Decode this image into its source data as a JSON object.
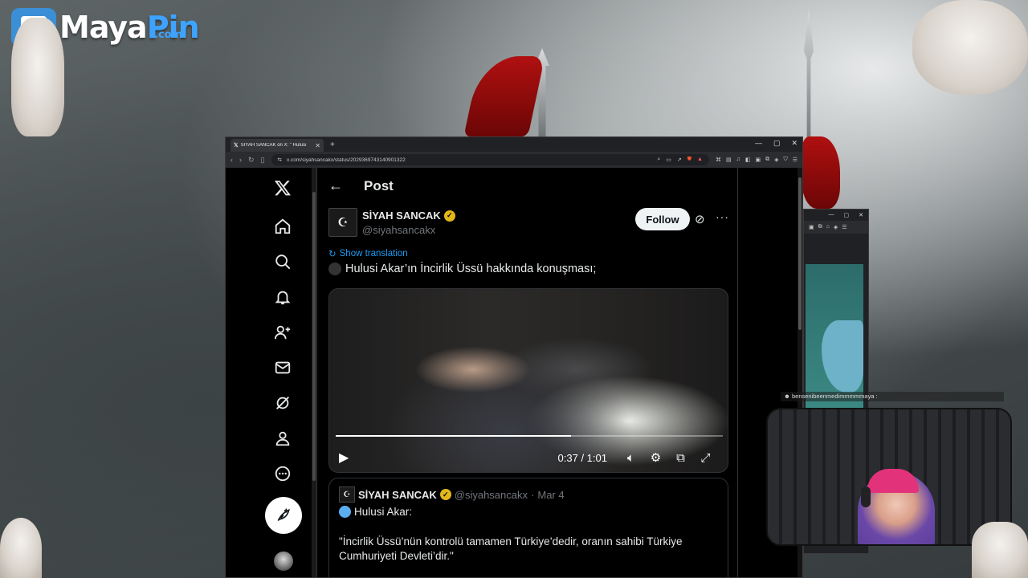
{
  "overlay": {
    "logo_main": "Maya",
    "logo_accent": "Pin",
    "logo_suffix": ".com",
    "chat_line": "☻ bensenibeenmedimmmmmaya :"
  },
  "browser": {
    "tab_title": "SİYAH SANCAK on X: \" Hulusi",
    "new_tab": "+",
    "url": "x.com/siyahsancakx/status/2029369743140901322"
  },
  "x": {
    "header_title": "Post",
    "author": {
      "name": "SİYAH SANCAK",
      "handle": "@siyahsancakx",
      "follow_label": "Follow"
    },
    "show_translation": "Show translation",
    "tweet_text": "Hulusi Akar’ın İncirlik Üssü hakkında konuşması;",
    "video": {
      "time": "0:37 / 1:01",
      "progress": 0.607
    },
    "quote": {
      "name": "SİYAH SANCAK",
      "handle": "@siyahsancakx",
      "date": "Mar 4",
      "line1": "Hulusi Akar:",
      "body": "\"İncirlik Üssü’nün kontrolü tamamen Türkiye’dedir, oranın sahibi Türkiye Cumhuriyeti Devleti’dir.\""
    },
    "sidebar": [
      "x-logo",
      "home",
      "explore",
      "notifications",
      "follow",
      "messages",
      "grok",
      "profile",
      "more"
    ]
  }
}
